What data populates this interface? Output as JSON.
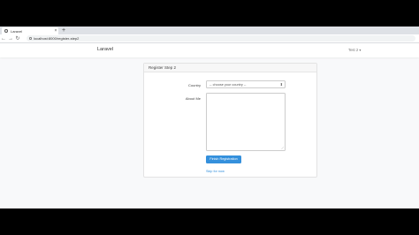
{
  "browser": {
    "tab_title": "Laravel",
    "tab_close": "×",
    "new_tab": "+",
    "back": "←",
    "forward": "→",
    "reload": "↻",
    "url": "localhost:8000/register-step2"
  },
  "navbar": {
    "brand": "Laravel",
    "user_menu": "Test 2 ▾"
  },
  "card": {
    "title": "Register Step 2",
    "country_label": "Country",
    "country_select_value": "-- choose your country --",
    "about_label": "About Me",
    "about_value": "",
    "finish_button": "Finish Registration",
    "skip_link": "Skip for now"
  },
  "colors": {
    "primary": "#3490dc",
    "page_bg": "#f8f9fa",
    "letterbox": "#000000"
  }
}
